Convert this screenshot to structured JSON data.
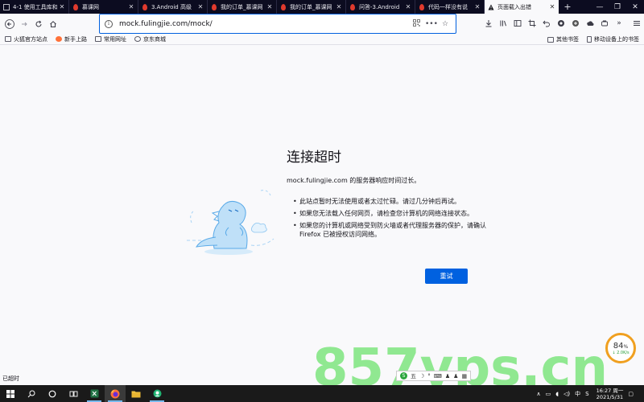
{
  "tabs": [
    {
      "title": "4-1 使用工具库和",
      "icon": "generic-icon",
      "active": false
    },
    {
      "title": "慕课网",
      "icon": "flame-icon",
      "active": false
    },
    {
      "title": "3.Android 高级",
      "icon": "flame-icon",
      "active": false
    },
    {
      "title": "我的订单_慕课网",
      "icon": "flame-icon",
      "active": false
    },
    {
      "title": "我的订单_慕课网",
      "icon": "flame-icon",
      "active": false
    },
    {
      "title": "问答-3.Android",
      "icon": "flame-icon",
      "active": false
    },
    {
      "title": "代码一样没有说",
      "icon": "flame-icon",
      "active": false
    },
    {
      "title": "页面载入出错",
      "icon": "warning-icon",
      "active": true
    }
  ],
  "urlbar": {
    "url": "mock.fulingjie.com/mock/"
  },
  "bookmarks": {
    "left": [
      {
        "label": "火狐官方站点",
        "icon": "folder-icon"
      },
      {
        "label": "新手上路",
        "icon": "firefox-icon"
      },
      {
        "label": "常用网址",
        "icon": "folder-icon"
      },
      {
        "label": "京东商城",
        "icon": "globe-icon"
      }
    ],
    "right": [
      {
        "label": "其他书签",
        "icon": "folder-icon"
      },
      {
        "label": "移动设备上的书签",
        "icon": "device-icon"
      }
    ]
  },
  "error": {
    "title": "连接超时",
    "description": "mock.fulingjie.com 的服务器响应时间过长。",
    "items": [
      "此站点暂时无法使用或者太过忙碌。请过几分钟后再试。",
      "如果您无法载入任何网页，请检查您计算机的网络连接状态。",
      "如果您的计算机或网络受到防火墙或者代理服务器的保护，请确认 Firefox 已被授权访问网络。"
    ],
    "retry_label": "重试"
  },
  "status": {
    "text": "已超时"
  },
  "overlay": {
    "watermark": "857vps.cn",
    "speed_value": "84",
    "speed_unit": "%",
    "speed_sub": "↓ 2.0K/s",
    "ime_items": [
      "五",
      "☽",
      "°",
      "⌨",
      "♟",
      "♟",
      "▦"
    ]
  },
  "taskbar": {
    "tray_lang": "中",
    "time": "16:27 周一",
    "date": "2021/5/31"
  },
  "colors": {
    "accent": "#0061e0",
    "tabstrip": "#0c0c20",
    "watermark": "#7ee57e"
  }
}
